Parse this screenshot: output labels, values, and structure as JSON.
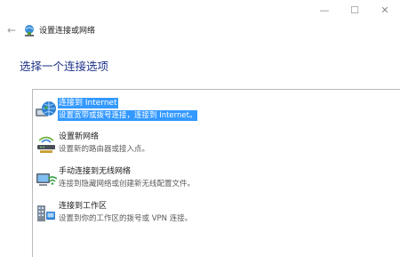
{
  "window": {
    "minimize_glyph": "—",
    "maximize_glyph": "☐",
    "close_glyph": "✕"
  },
  "nav": {
    "back_glyph": "←",
    "icon": "network-setup-icon",
    "title": "设置连接或网络"
  },
  "heading": "选择一个连接选项",
  "options": [
    {
      "title": "连接到 Internet",
      "desc": "设置宽带或拨号连接，连接到 Internet。",
      "icon": "globe-internet-icon",
      "selected": true
    },
    {
      "title": "设置新网络",
      "desc": "设置新的路由器或接入点。",
      "icon": "router-network-icon",
      "selected": false
    },
    {
      "title": "手动连接到无线网络",
      "desc": "连接到隐藏网络或创建新无线配置文件。",
      "icon": "wireless-network-icon",
      "selected": false
    },
    {
      "title": "连接到工作区",
      "desc": "设置到你的工作区的拨号或 VPN 连接。",
      "icon": "workplace-vpn-icon",
      "selected": false
    }
  ],
  "colors": {
    "heading": "#1e3287",
    "selection": "#3399ff"
  }
}
